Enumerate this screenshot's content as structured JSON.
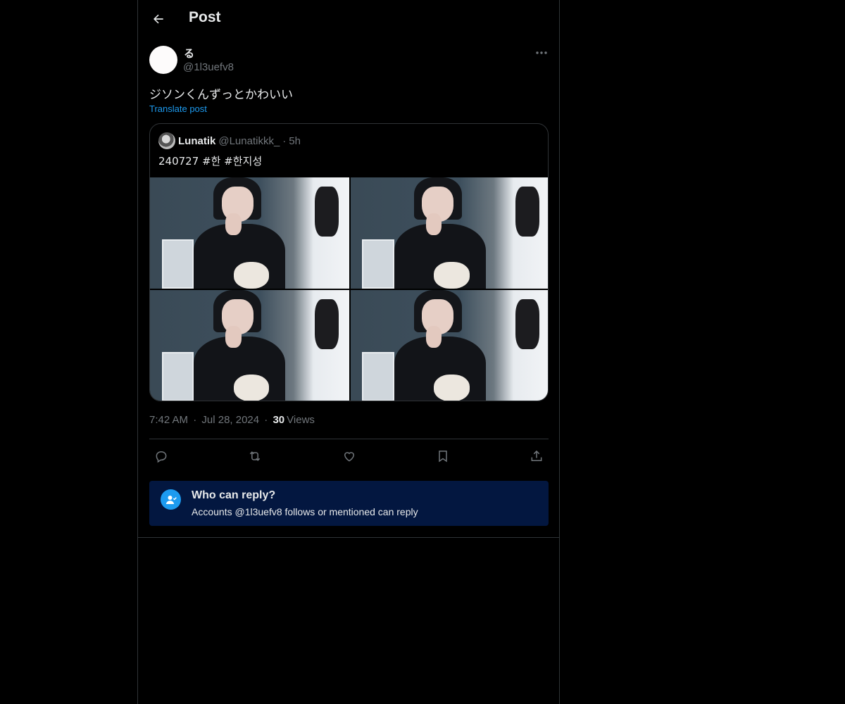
{
  "header": {
    "title": "Post"
  },
  "post": {
    "author_name": "る",
    "author_handle": "@1l3uefv8",
    "text": "ジソンくんずっとかわいい",
    "translate_label": "Translate post",
    "time": "7:42 AM",
    "date": "Jul 28, 2024",
    "separator": "·",
    "views_count": "30",
    "views_label": "Views"
  },
  "quote": {
    "name": "Lunatik",
    "handle": "@Lunatikkk_",
    "separator": "·",
    "time": "5h",
    "text": "240727 #한 #한지성"
  },
  "actions": [
    {
      "icon": "reply-icon"
    },
    {
      "icon": "repost-icon"
    },
    {
      "icon": "like-icon"
    },
    {
      "icon": "bookmark-icon"
    },
    {
      "icon": "share-icon"
    }
  ],
  "reply_restriction": {
    "title": "Who can reply?",
    "description": "Accounts @1l3uefv8 follows or mentioned can reply"
  },
  "colors": {
    "background": "#000000",
    "accent": "#1d9bf0",
    "muted_text": "#71767b",
    "reply_box": "#031740"
  }
}
